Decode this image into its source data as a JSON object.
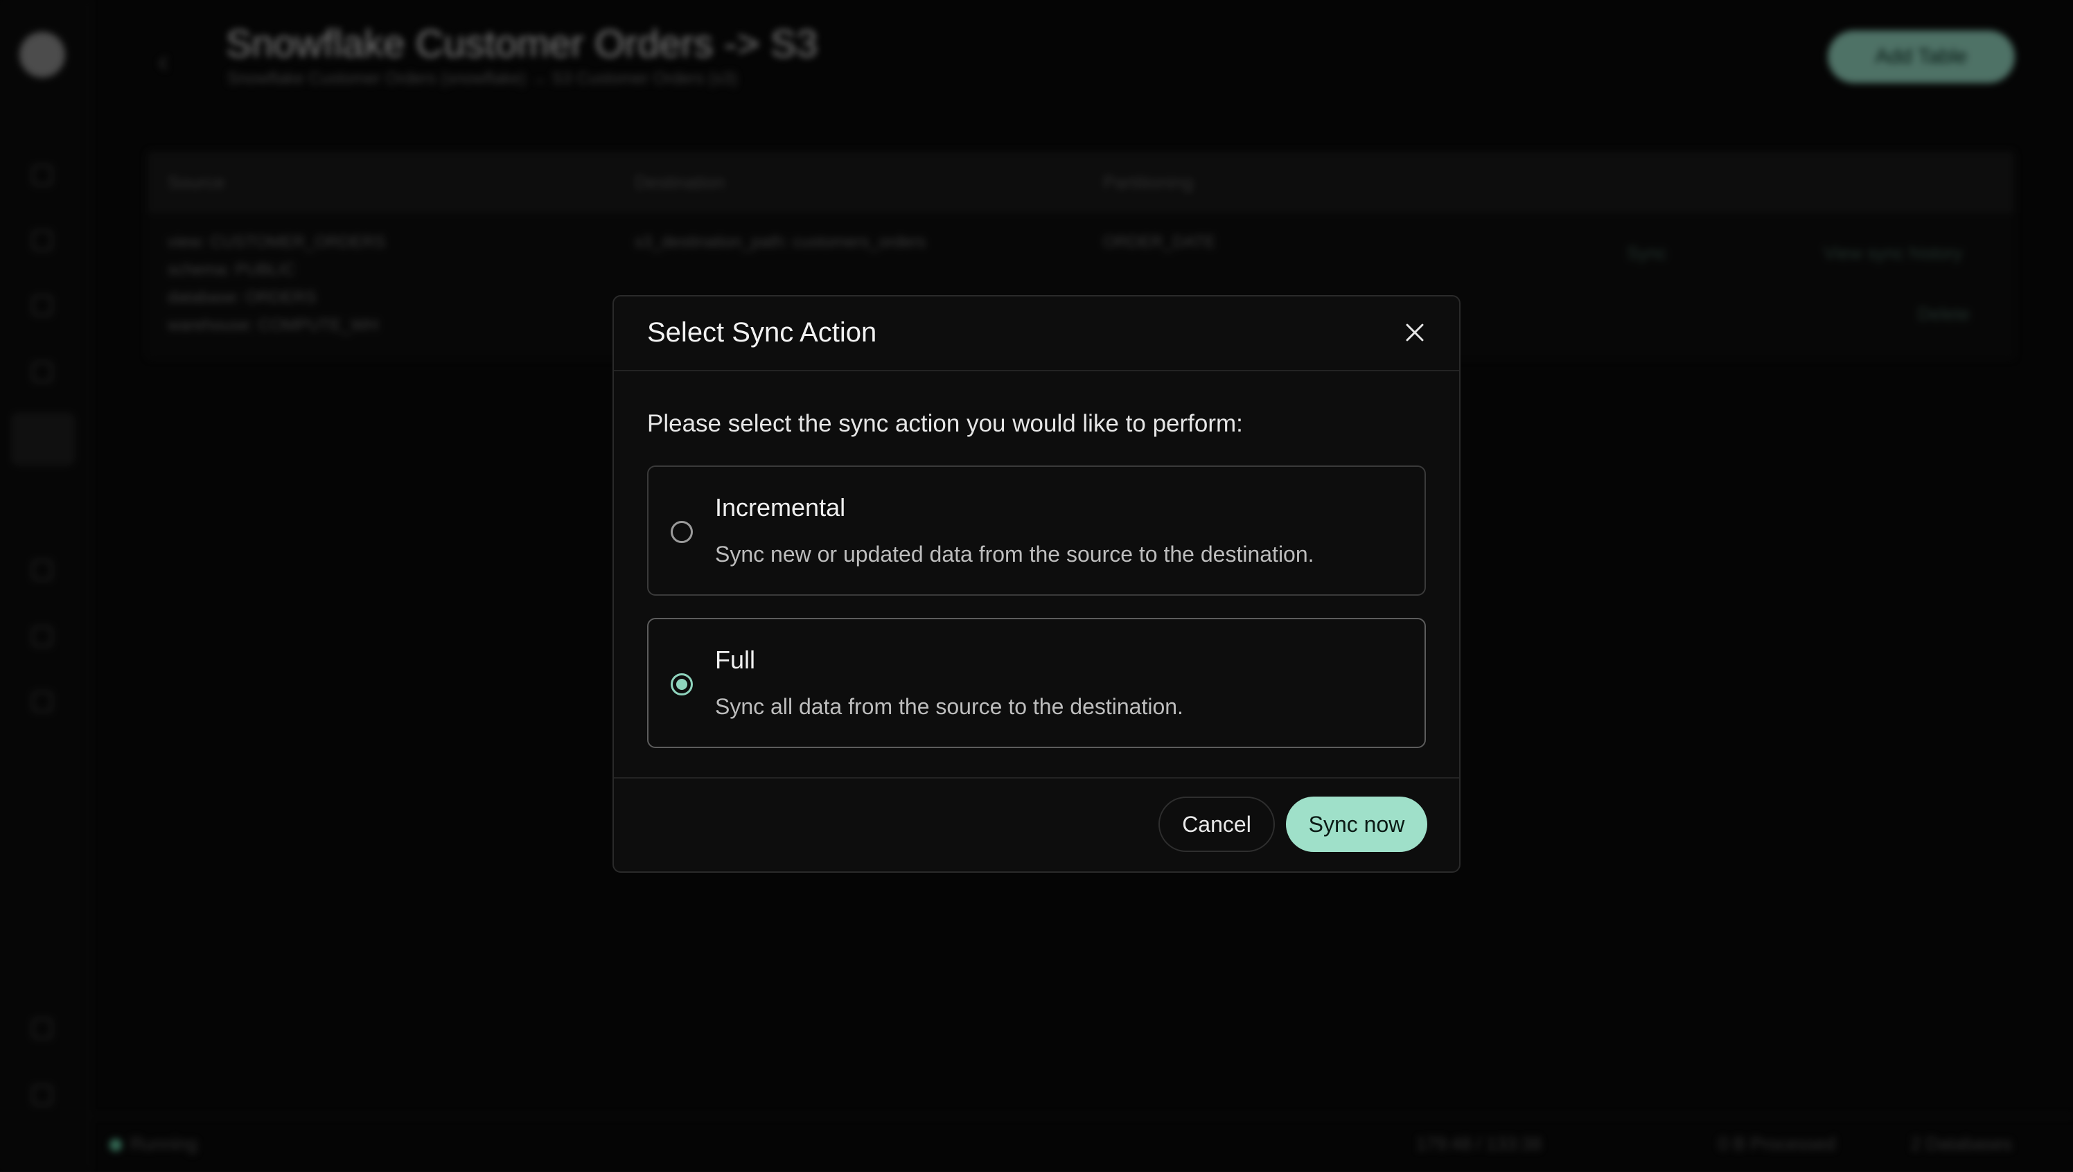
{
  "background": {
    "page_title": "Snowflake Customer Orders -> S3",
    "page_subtitle": "Snowflake Customer Orders (snowflake) → S3 Customer Orders (s3)",
    "add_button": "Add Table",
    "table": {
      "headers": [
        "Source",
        "Destination",
        "Partitioning"
      ],
      "source_cell": "view: CUSTOMER_ORDERS\nschema: PUBLIC\ndatabase: ORDERS\nwarehouse: COMPUTE_WH",
      "destination_cell": "s3_destination_path: customers_orders",
      "partitioning_cell": "ORDER_DATE",
      "sync_button": "Sync",
      "history_button": "View sync history",
      "delete_button": "Delete"
    },
    "status": {
      "state": "Running",
      "time": "179:48 / 133:38",
      "processed": "0 B Processed",
      "databases": "2 Databases"
    }
  },
  "modal": {
    "title": "Select Sync Action",
    "prompt": "Please select the sync action you would like to perform:",
    "options": [
      {
        "title": "Incremental",
        "description": "Sync new or updated data from the source to the destination.",
        "selected": false
      },
      {
        "title": "Full",
        "description": "Sync all data from the source to the destination.",
        "selected": true
      }
    ],
    "cancel_label": "Cancel",
    "confirm_label": "Sync now"
  },
  "colors": {
    "accent": "#9fe0c9",
    "background": "#0a0a0a",
    "modal_background": "#0d0d0d"
  }
}
